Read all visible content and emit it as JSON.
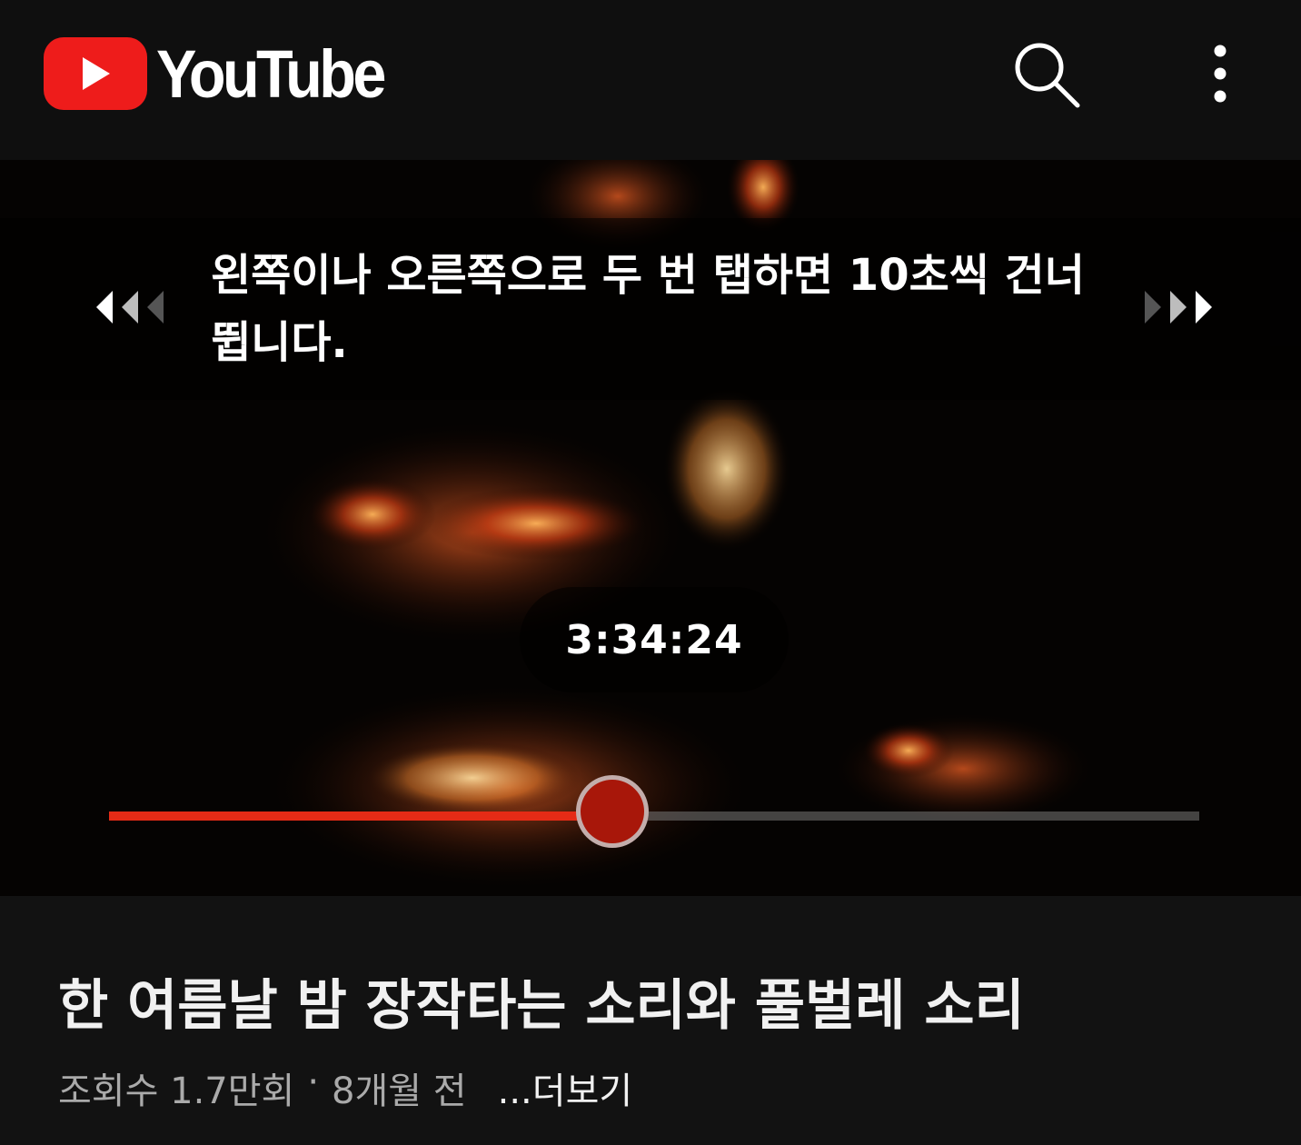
{
  "header": {
    "brand": "YouTube",
    "brand_color": "#ee1c1b",
    "icons": [
      "youtube-play-icon",
      "search-icon",
      "more-vert-icon"
    ]
  },
  "player": {
    "hint": "왼쪽이나 오른쪽으로 두 번 탭하면 10초씩 건너뜁니다.",
    "current_time": "3:34:24",
    "progress_fraction": 0.462,
    "played_color": "#e52b16"
  },
  "video": {
    "title": "한 여름날 밤 장작타는 소리와 풀벌레 소리",
    "views": "조회수 1.7만회",
    "separator": "·",
    "age": "8개월 전",
    "more": "...더보기"
  }
}
